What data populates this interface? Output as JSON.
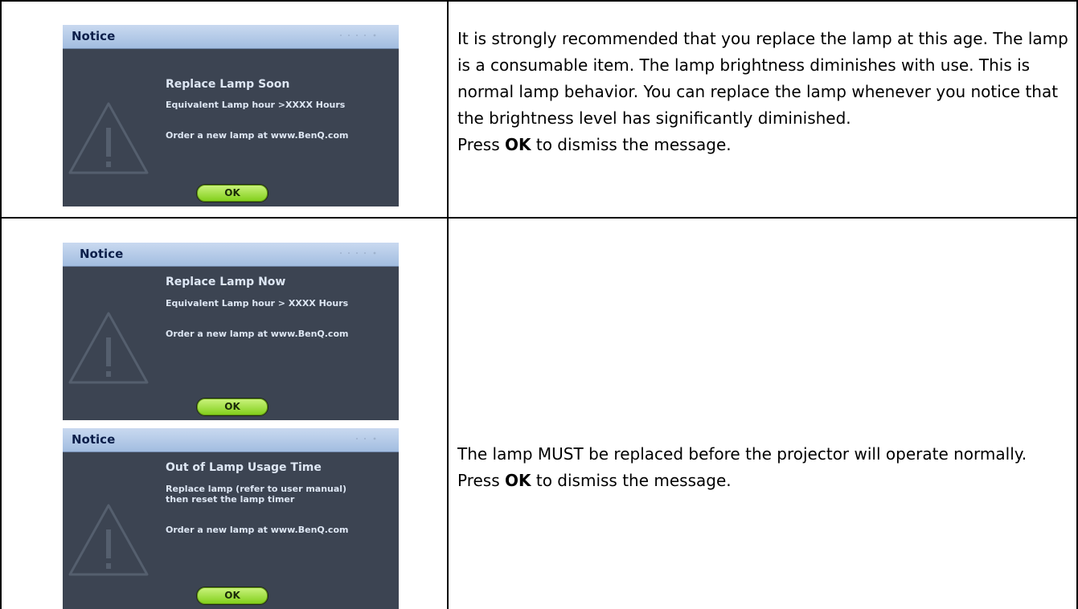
{
  "rows": [
    {
      "dialogs": [
        {
          "title": "Notice",
          "heading": "Replace Lamp Soon",
          "lines": [
            "Equivalent Lamp hour >XXXX Hours",
            "Order a new lamp at www.BenQ.com"
          ],
          "ok_label": "OK"
        }
      ],
      "description": {
        "text": "It is strongly recommended that you replace the lamp at this age. The lamp is a consumable item. The lamp brightness diminishes with use. This is normal lamp behavior. You can replace the lamp whenever you notice that the brightness level has significantly diminished.",
        "press_prefix": "Press",
        "press_key": "OK",
        "press_suffix": "to dismiss the message."
      }
    },
    {
      "dialogs": [
        {
          "title": "Notice",
          "heading": "Replace Lamp Now",
          "lines": [
            "Equivalent Lamp hour > XXXX Hours",
            "Order a new lamp at www.BenQ.com"
          ],
          "ok_label": "OK"
        },
        {
          "title": "Notice",
          "heading": "Out of Lamp Usage Time",
          "lines": [
            "Replace lamp (refer to user manual)",
            "then reset the lamp timer",
            "Order a new lamp at www.BenQ.com"
          ],
          "ok_label": "OK"
        }
      ],
      "description": {
        "text": "The lamp MUST be replaced before the projector will operate normally.",
        "press_prefix": "Press",
        "press_key": "OK",
        "press_suffix": "to dismiss the message."
      }
    }
  ],
  "colors": {
    "dialog_body": "#3c4452",
    "titlebar": "#b3cbea",
    "ok_button": "#9fe33a",
    "text_light": "#dde6f3"
  }
}
